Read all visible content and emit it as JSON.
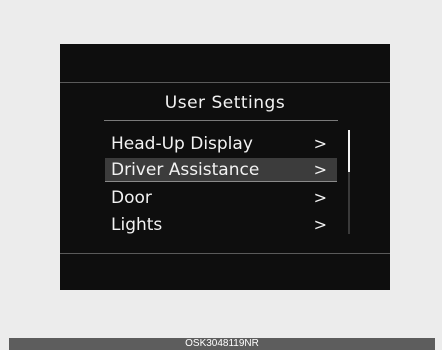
{
  "menu": {
    "title": "User Settings",
    "items": [
      {
        "label": "Head-Up Display",
        "arrow": ">"
      },
      {
        "label": "Driver Assistance",
        "arrow": ">"
      },
      {
        "label": "Door",
        "arrow": ">"
      },
      {
        "label": "Lights",
        "arrow": ">"
      }
    ],
    "selected_index": 1
  },
  "caption": "OSK3048119NR"
}
